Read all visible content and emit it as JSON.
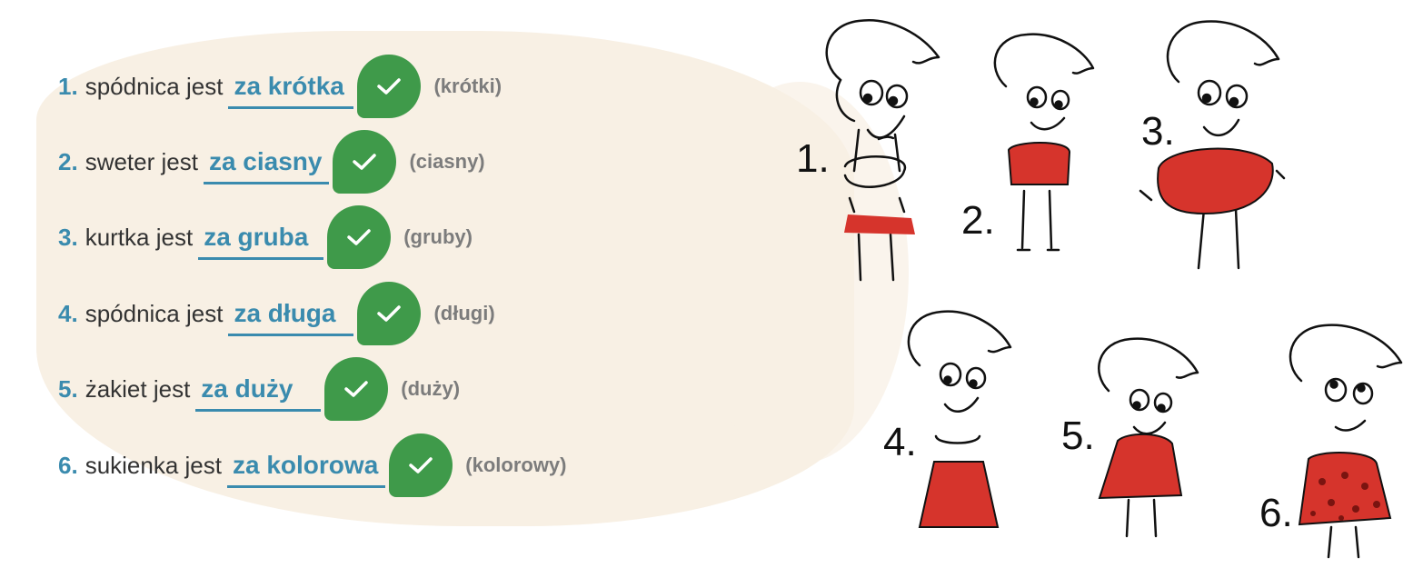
{
  "exercise": {
    "items": [
      {
        "number": "1.",
        "prompt": "spódnica jest",
        "answer": "za krótka",
        "hint": "(krótki)"
      },
      {
        "number": "2.",
        "prompt": "sweter jest",
        "answer": "za ciasny",
        "hint": "(ciasny)"
      },
      {
        "number": "3.",
        "prompt": "kurtka jest",
        "answer": "za gruba",
        "hint": "(gruby)"
      },
      {
        "number": "4.",
        "prompt": "spódnica jest",
        "answer": "za długa",
        "hint": "(długi)"
      },
      {
        "number": "5.",
        "prompt": "żakiet jest",
        "answer": "za duży",
        "hint": "(duży)"
      },
      {
        "number": "6.",
        "prompt": "sukienka jest",
        "answer": "za kolorowa",
        "hint": "(kolorowy)"
      }
    ],
    "check_icon": "checkmark-icon"
  },
  "illustrations": {
    "labels": [
      "1.",
      "2.",
      "3.",
      "4.",
      "5.",
      "6."
    ],
    "clothing_color": "#d6342c",
    "hair_color": "#ffffff"
  },
  "colors": {
    "accent": "#3a8bae",
    "correct": "#3f9a4a",
    "background": "#f8f0e4"
  }
}
